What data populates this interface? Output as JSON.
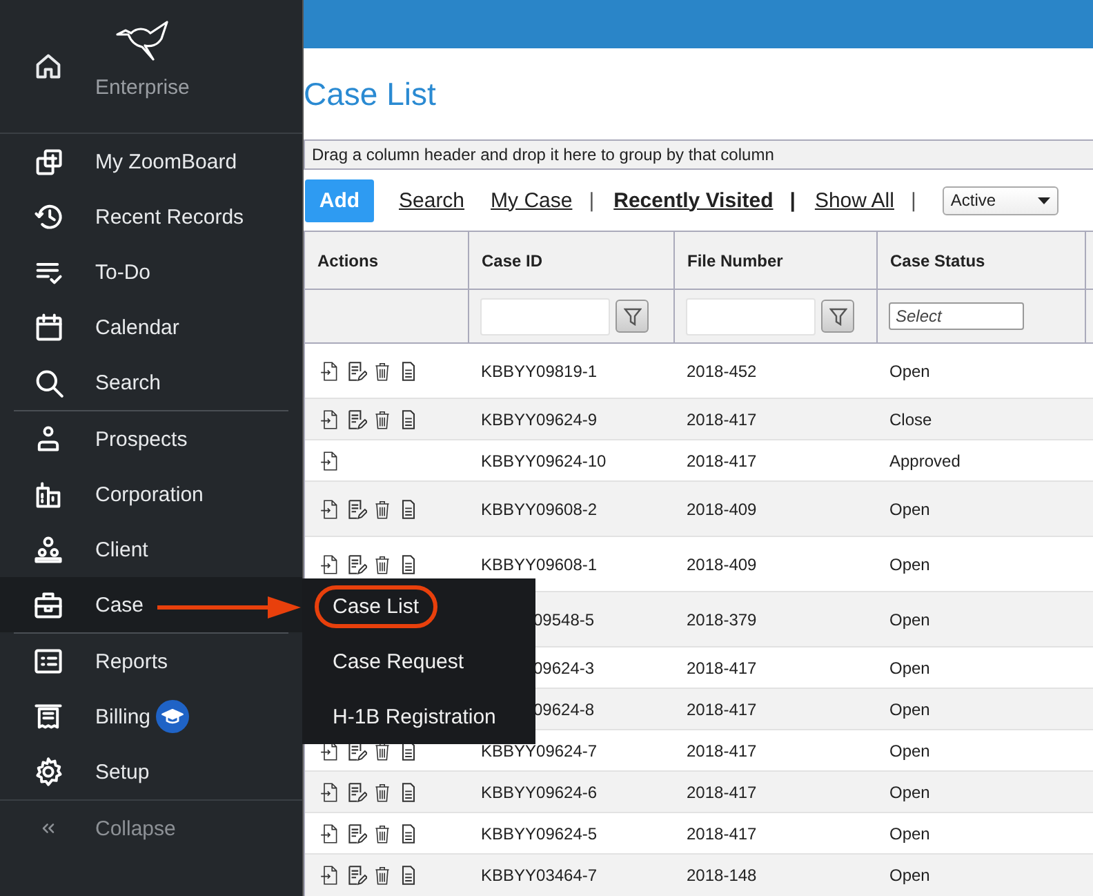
{
  "sidebar": {
    "brand": "Enterprise",
    "sections": [
      [
        {
          "label": "My ZoomBoard",
          "selected": false
        },
        {
          "label": "Recent Records",
          "selected": false
        },
        {
          "label": "To-Do",
          "selected": false
        },
        {
          "label": "Calendar",
          "selected": false
        },
        {
          "label": "Search",
          "selected": false
        }
      ],
      [
        {
          "label": "Prospects",
          "selected": false
        },
        {
          "label": "Corporation",
          "selected": false
        },
        {
          "label": "Client",
          "selected": false
        },
        {
          "label": "Case",
          "selected": true
        }
      ],
      [
        {
          "label": "Reports",
          "selected": false
        },
        {
          "label": "Billing",
          "selected": false,
          "badge": true
        },
        {
          "label": "Setup",
          "selected": false
        }
      ]
    ],
    "collapse": {
      "label": "Collapse"
    }
  },
  "submenu": {
    "items": [
      {
        "label": "Case List",
        "selected": true
      },
      {
        "label": "Case Request",
        "selected": false
      },
      {
        "label": "H-1B Registration",
        "selected": false
      }
    ]
  },
  "page": {
    "title": "Case List",
    "group_hint": "Drag a column header and drop it here to group by that column"
  },
  "toolbar": {
    "add": "Add",
    "links": [
      {
        "label": "Search",
        "selected": false
      },
      {
        "label": "My Case",
        "selected": false,
        "separator": "|"
      },
      {
        "label": "Recently Visited",
        "selected": true,
        "separator": "|"
      },
      {
        "label": "Show All",
        "selected": false,
        "separator": "|"
      }
    ],
    "status_filter": "Active"
  },
  "table": {
    "columns": [
      "Actions",
      "Case ID",
      "File Number",
      "Case Status"
    ],
    "status_placeholder": "Select",
    "rows": [
      {
        "actions": [
          {
            "kind": "open"
          },
          {
            "kind": "edit"
          },
          {
            "kind": "delete"
          },
          {
            "kind": "document"
          }
        ],
        "case_id": "KBBYY09819-1",
        "file_number": "2018-452",
        "status": "Open"
      },
      {
        "actions": [
          {
            "kind": "open"
          },
          {
            "kind": "edit"
          },
          {
            "kind": "delete"
          },
          {
            "kind": "document"
          }
        ],
        "case_id": "KBBYY09624-9",
        "file_number": "2018-417",
        "status": "Close"
      },
      {
        "actions": [
          {
            "kind": "open"
          }
        ],
        "case_id": "KBBYY09624-10",
        "file_number": "2018-417",
        "status": "Approved"
      },
      {
        "actions": [
          {
            "kind": "open"
          },
          {
            "kind": "edit"
          },
          {
            "kind": "delete"
          },
          {
            "kind": "document"
          }
        ],
        "case_id": "KBBYY09608-2",
        "file_number": "2018-409",
        "status": "Open"
      },
      {
        "actions": [
          {
            "kind": "open"
          },
          {
            "kind": "edit"
          },
          {
            "kind": "delete"
          },
          {
            "kind": "document"
          }
        ],
        "case_id": "KBBYY09608-1",
        "file_number": "2018-409",
        "status": "Open"
      },
      {
        "covered": true,
        "case_id": "09548-5",
        "file_number": "2018-379",
        "status": "Open"
      },
      {
        "covered": true,
        "case_id": "09624-3",
        "file_number": "2018-417",
        "status": "Open"
      },
      {
        "covered": true,
        "case_id": "09624-8",
        "file_number": "2018-417",
        "status": "Open"
      },
      {
        "actions": [
          {
            "kind": "open"
          },
          {
            "kind": "edit"
          },
          {
            "kind": "delete"
          },
          {
            "kind": "document"
          }
        ],
        "case_id": "KBBYY09624-7",
        "file_number": "2018-417",
        "status": "Open"
      },
      {
        "actions": [
          {
            "kind": "open"
          },
          {
            "kind": "edit"
          },
          {
            "kind": "delete"
          },
          {
            "kind": "document"
          }
        ],
        "case_id": "KBBYY09624-6",
        "file_number": "2018-417",
        "status": "Open"
      },
      {
        "actions": [
          {
            "kind": "open"
          },
          {
            "kind": "edit"
          },
          {
            "kind": "delete"
          },
          {
            "kind": "document"
          }
        ],
        "case_id": "KBBYY09624-5",
        "file_number": "2018-417",
        "status": "Open"
      },
      {
        "actions": [
          {
            "kind": "open"
          },
          {
            "kind": "edit"
          },
          {
            "kind": "delete"
          },
          {
            "kind": "document"
          }
        ],
        "case_id": "KBBYY03464-7",
        "file_number": "2018-148",
        "status": "Open"
      }
    ]
  }
}
